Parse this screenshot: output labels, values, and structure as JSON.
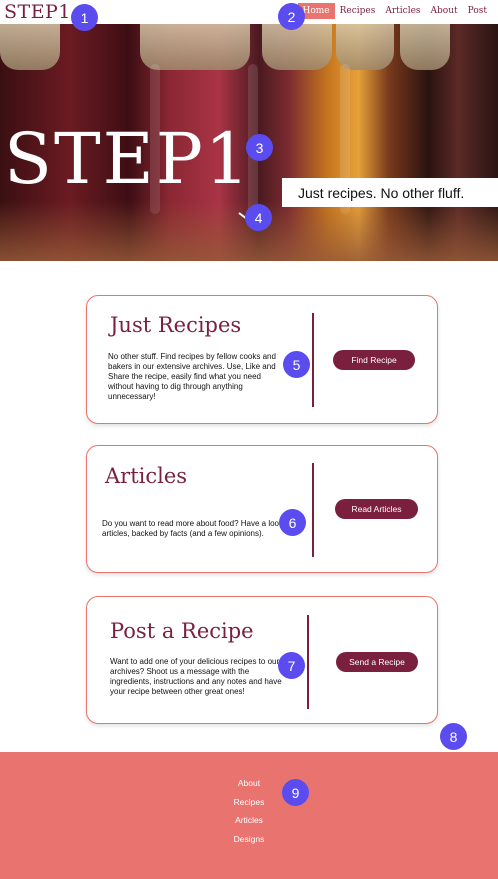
{
  "header": {
    "logo": "STEP1",
    "nav": [
      {
        "label": "Home",
        "active": true
      },
      {
        "label": "Recipes"
      },
      {
        "label": "Articles"
      },
      {
        "label": "About"
      },
      {
        "label": "Post"
      }
    ]
  },
  "hero": {
    "title": "STEP1",
    "tagline": "Just recipes. No other fluff."
  },
  "cards": [
    {
      "title": "Just Recipes",
      "text": "No other stuff. Find recipes by fellow cooks and bakers in our extensive archives. Use, Like and Share the recipe, easily find what you need without having to dig through anything unnecessary!",
      "button": "Find Recipe"
    },
    {
      "title": "Articles",
      "text": "Do you want to read more about food? Have a look at our articles, backed by facts (and a few opinions).",
      "button": "Read Articles"
    },
    {
      "title": "Post a Recipe",
      "text": "Want to add one of your delicious recipes to our archives? Shoot us a message with the ingredients, instructions and any notes and have your recipe between other great ones!",
      "button": "Send a Recipe"
    }
  ],
  "footer": {
    "links": [
      "About",
      "Recipes",
      "Articles",
      "Designs"
    ]
  },
  "markers": [
    "1",
    "2",
    "3",
    "4",
    "5",
    "6",
    "7",
    "8",
    "9"
  ],
  "colors": {
    "accent": "#e8736f",
    "brand": "#7a1f3d",
    "marker": "#5b4cf0"
  }
}
